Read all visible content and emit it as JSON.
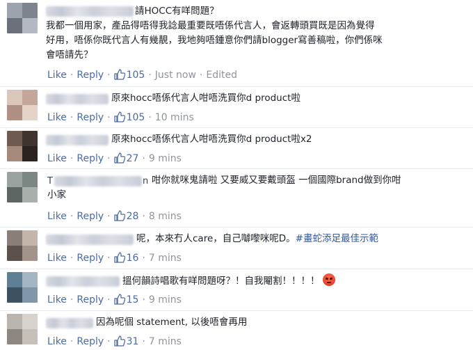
{
  "comments": [
    {
      "text": "請HOCC有咩問題？\n我都一個用家，產品得唔得我諗最重要既唔係代言人，會返轉頭買既是因為覺得\n好用，唔係你既代言人有幾靚，我地夠唔鍾意你們請blogger寫善稿啦，你們係咪\n會唔請先？",
      "like": "Like",
      "reply": "Reply",
      "count": "105",
      "time": "Just now",
      "extra": "Edited"
    },
    {
      "text": "原來hocc唔係代言人咁唔洗買你d product啦",
      "like": "Like",
      "reply": "Reply",
      "count": "105",
      "time": "10 mins"
    },
    {
      "text": "原來hocc唔係代言人咁唔洗買你d product啦x2",
      "like": "Like",
      "reply": "Reply",
      "count": "27",
      "time": "9 mins"
    },
    {
      "name_start": "T",
      "name_end": "n",
      "text": "咁你就咪鬼請啦 又要威又要戴頭盔 一個國際brand做到你咁\n小家",
      "like": "Like",
      "reply": "Reply",
      "count": "28",
      "time": "8 mins"
    },
    {
      "text": "呢，本來冇人care，自己嚹嚟咪呢D。",
      "hashtag": "#畫蛇添足最佳示範",
      "like": "Like",
      "reply": "Reply",
      "count": "16",
      "time": "7 mins"
    },
    {
      "text": "搵何韻詩唱歌有咩問題呀？！自我閹割！！！！",
      "like": "Like",
      "reply": "Reply",
      "count": "15",
      "time": "9 mins"
    },
    {
      "text": "因為呢個 statement, 以後唔會再用",
      "like": "Like",
      "reply": "Reply",
      "count": "31",
      "time": "7 mins"
    }
  ],
  "colors": {
    "link": "#4b6ba4",
    "meta": "#90949c",
    "text": "#1d2129",
    "hashtag": "#365899"
  },
  "icons": {
    "like_count": "thumbs-up-icon",
    "reaction": "angry-face-emoji"
  }
}
